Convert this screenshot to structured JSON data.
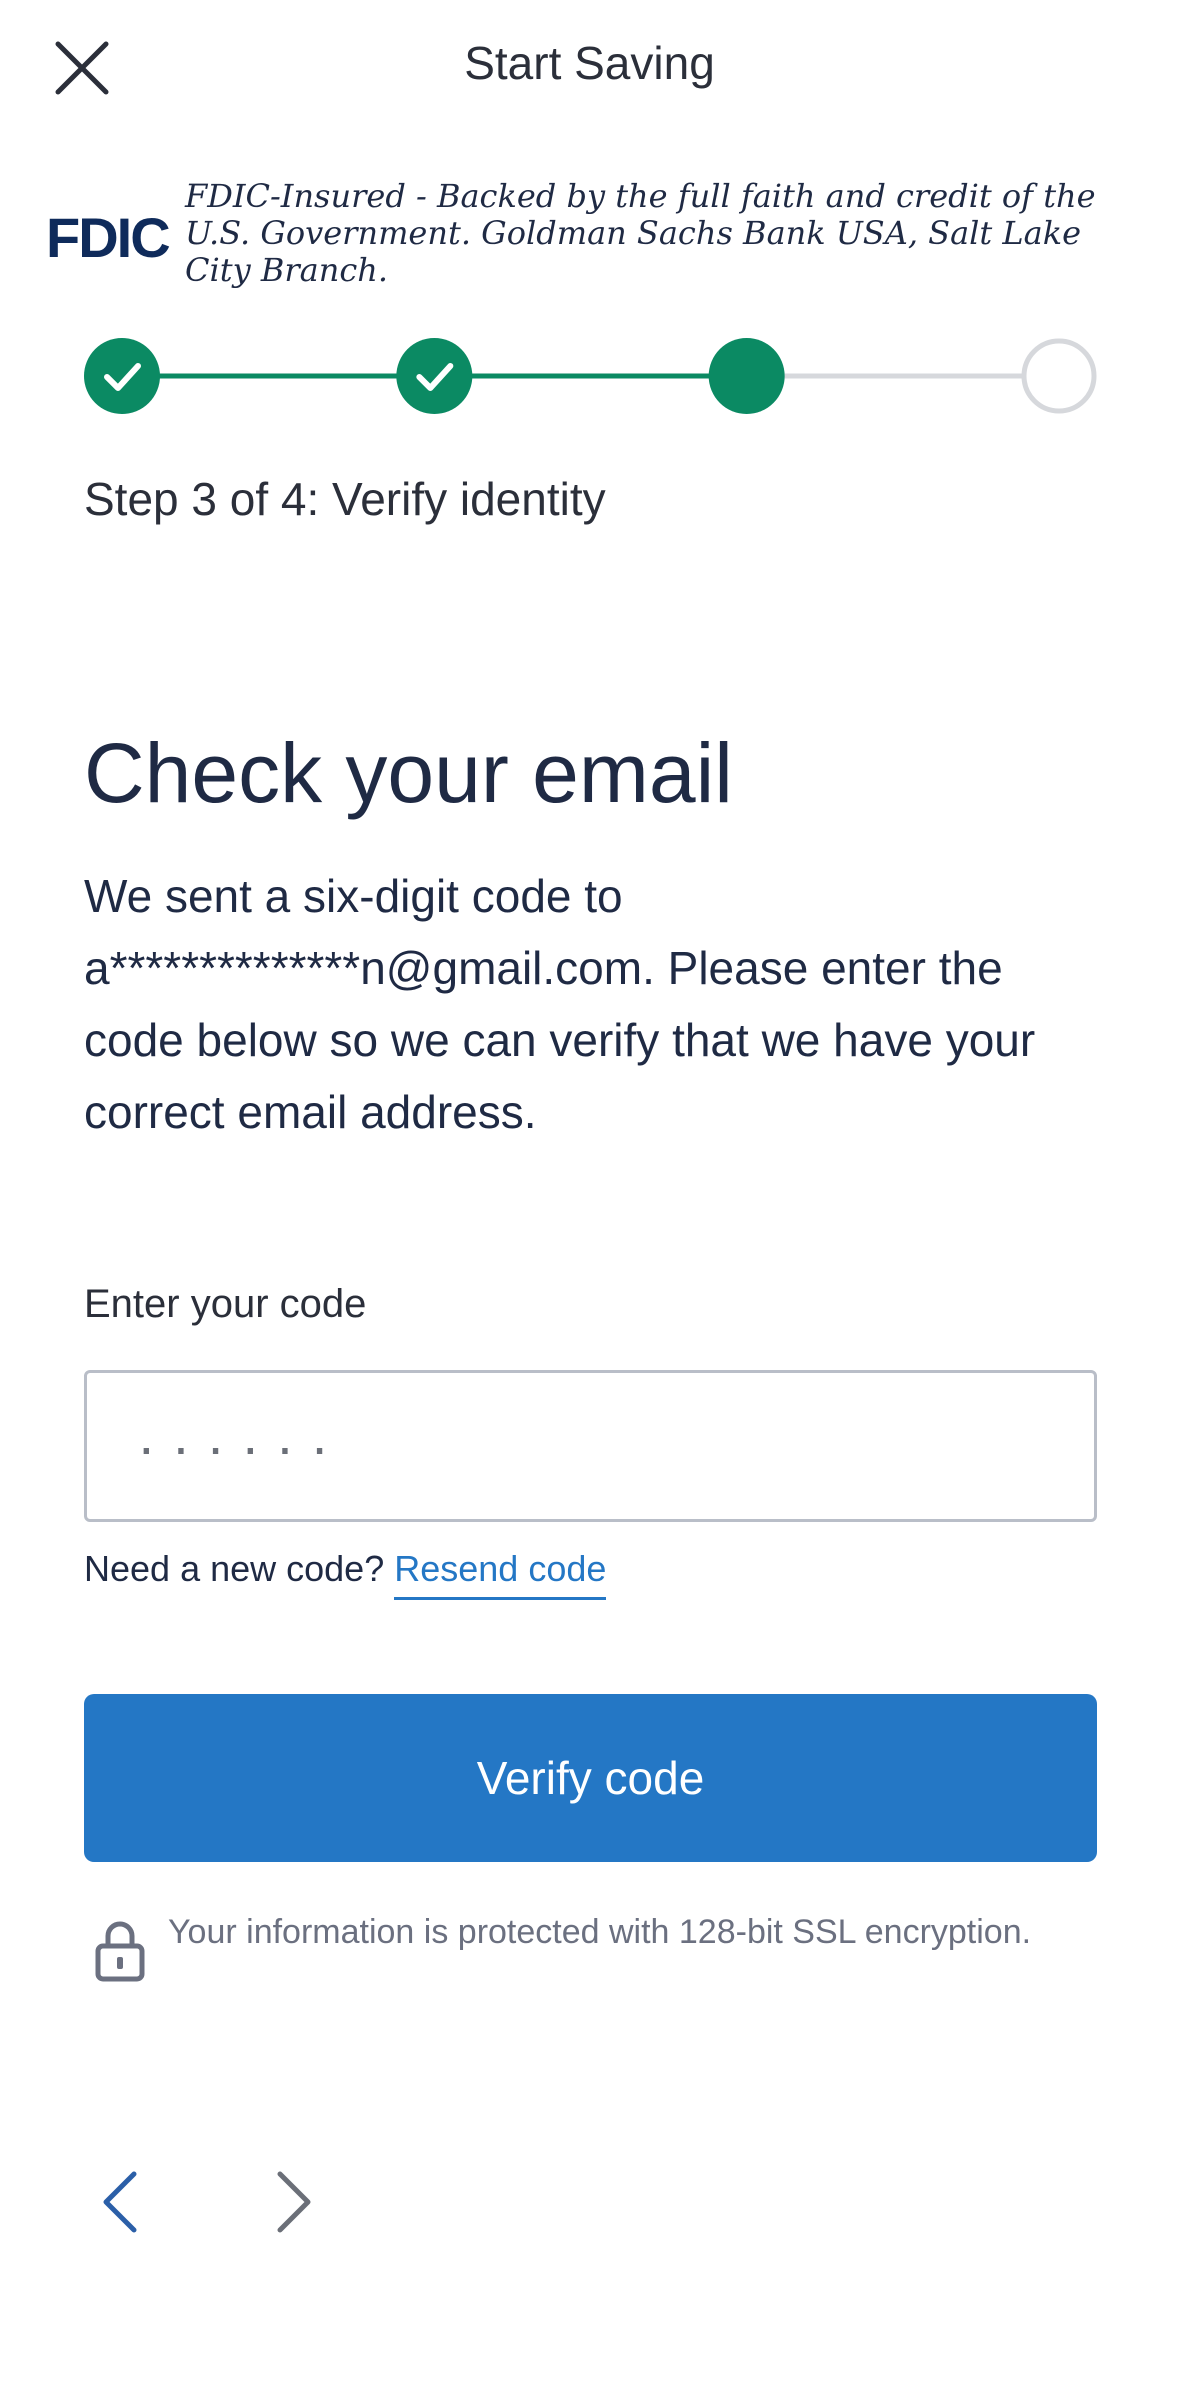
{
  "header": {
    "title": "Start Saving"
  },
  "banner": {
    "logo_text": "FDIC",
    "text": "FDIC-Insured - Backed by the full faith and credit of the U.S. Government. Goldman Sachs Bank USA, Salt Lake City Branch."
  },
  "progress": {
    "total_steps": 4,
    "current_step": 3,
    "completed_steps": 2,
    "label": "Step 3 of 4: Verify identity"
  },
  "main": {
    "heading": "Check your email",
    "body": "We sent a six-digit code to a**************n@gmail.com. Please enter the code below so we can verify that we have your correct email address.",
    "input_label": "Enter your code",
    "input_placeholder": "······",
    "input_value": "",
    "resend_prompt": "Need a new code?",
    "resend_link": "Resend code",
    "verify_button": "Verify code",
    "ssl_notice": "Your information is protected with 128-bit SSL encryption."
  },
  "icons": {
    "close": "close-icon",
    "check": "check-icon",
    "lock": "lock-icon",
    "back": "chevron-left-icon",
    "forward": "chevron-right-icon"
  },
  "colors": {
    "accent_green": "#0b8a63",
    "primary_blue": "#2477c5",
    "inactive_gray": "#d6d8dc",
    "fdic_navy": "#0f2b5b"
  }
}
